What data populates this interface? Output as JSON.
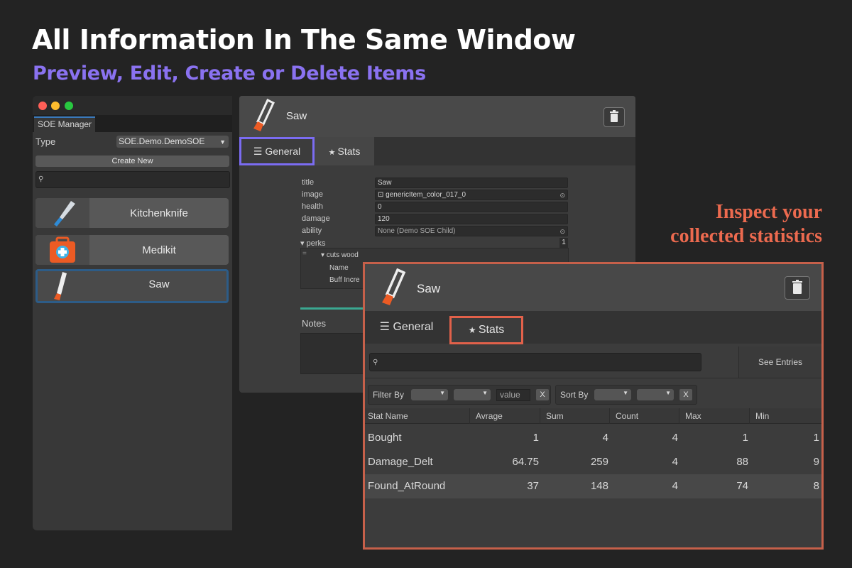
{
  "headline": "All Information In The Same Window",
  "subline": "Preview, Edit, Create or Delete Items",
  "callout": {
    "line1": "Inspect your",
    "line2": "collected statistics"
  },
  "colors": {
    "accent_purple": "#7b6cf2",
    "accent_orange": "#e2614a",
    "selection_blue": "#2d5c87"
  },
  "manager": {
    "tab_label": "SOE Manager",
    "type_label": "Type",
    "type_value": "SOE.Demo.DemoSOE",
    "create_button": "Create New",
    "search_placeholder": "",
    "items": [
      {
        "label": "Kitchenknife",
        "icon": "knife-icon"
      },
      {
        "label": "Medikit",
        "icon": "medikit-icon"
      },
      {
        "label": "Saw",
        "icon": "saw-icon",
        "selected": true
      }
    ]
  },
  "editor": {
    "item_name": "Saw",
    "tabs": {
      "general": "General",
      "stats": "Stats"
    },
    "fields": [
      {
        "key": "title",
        "value": "Saw"
      },
      {
        "key": "image",
        "value": "genericItem_color_017_0"
      },
      {
        "key": "health",
        "value": "0"
      },
      {
        "key": "damage",
        "value": "120"
      },
      {
        "key": "ability",
        "value": "None (Demo SOE Child)"
      }
    ],
    "perks_label": "perks",
    "perks_count": "1",
    "perk_name": "cuts wood",
    "perk_field_name": "Name",
    "perk_field_buff": "Buff Incre",
    "notes_label": "Notes"
  },
  "stats": {
    "item_name": "Saw",
    "tabs": {
      "general": "General",
      "stats": "Stats"
    },
    "see_entries": "See Entries",
    "filter_by": "Filter By",
    "value_placeholder": "value",
    "sort_by": "Sort By",
    "clear": "X",
    "columns": [
      "Stat Name",
      "Avrage",
      "Sum",
      "Count",
      "Max",
      "Min"
    ],
    "rows": [
      {
        "name": "Bought",
        "avg": "1",
        "sum": "4",
        "count": "4",
        "max": "1",
        "min": "1"
      },
      {
        "name": "Damage_Delt",
        "avg": "64.75",
        "sum": "259",
        "count": "4",
        "max": "88",
        "min": "9"
      },
      {
        "name": "Found_AtRound",
        "avg": "37",
        "sum": "148",
        "count": "4",
        "max": "74",
        "min": "8"
      }
    ]
  }
}
